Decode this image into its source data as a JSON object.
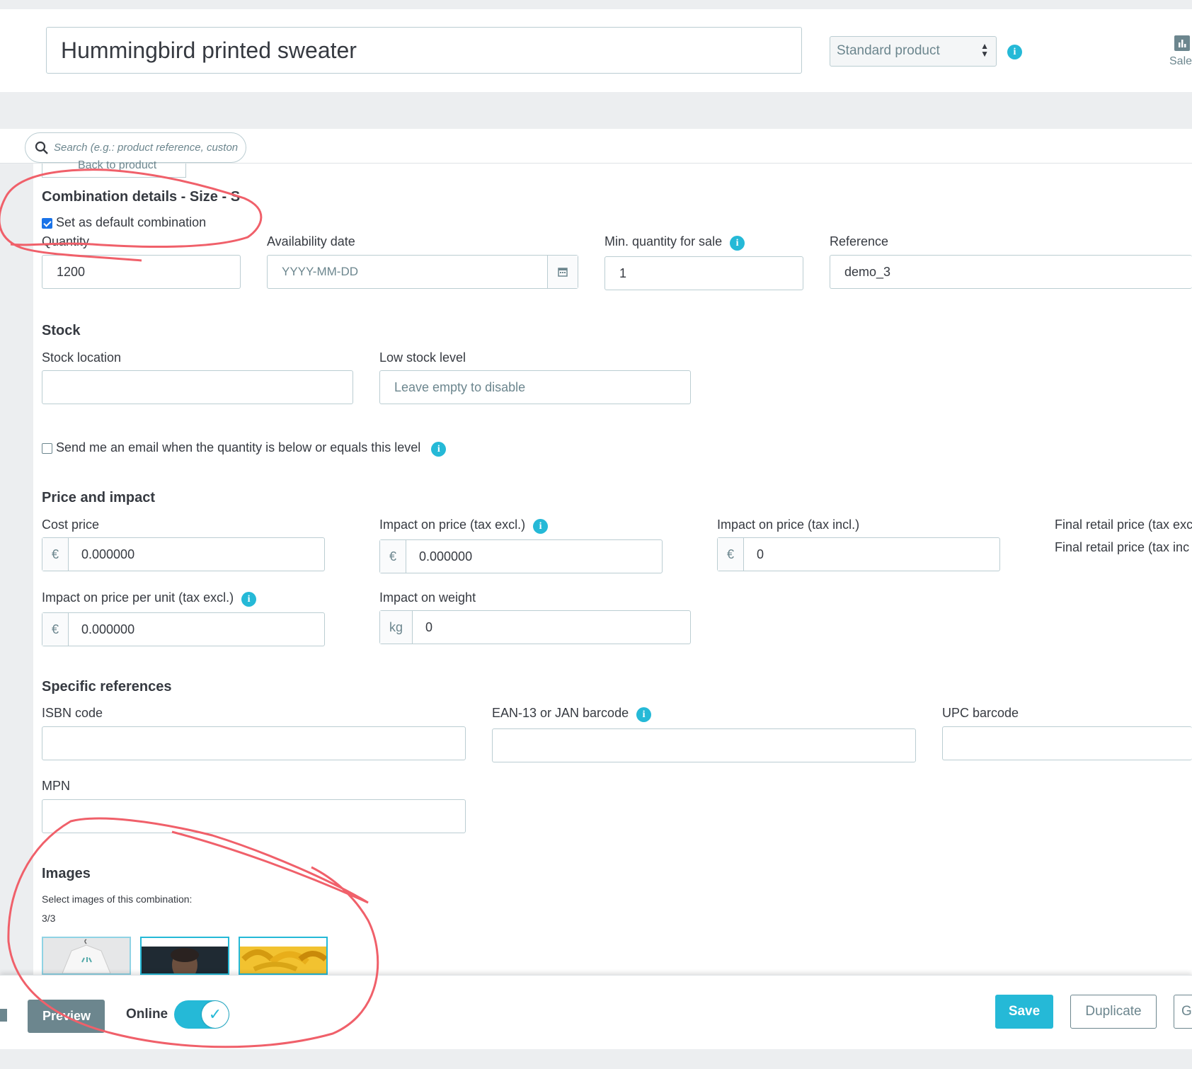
{
  "header": {
    "product_name": "Hummingbird printed sweater",
    "product_type": "Standard product",
    "sales_label": "Sales"
  },
  "search": {
    "placeholder": "Search (e.g.: product reference, custon"
  },
  "back_button": {
    "label": "Back to product"
  },
  "combination": {
    "title": "Combination details - Size - S",
    "default_label": "Set as default combination",
    "default_checked": true,
    "quantity_label": "Quantity",
    "quantity_value": "1200",
    "availability_label": "Availability date",
    "availability_placeholder": "YYYY-MM-DD",
    "min_qty_label": "Min. quantity for sale",
    "min_qty_value": "1",
    "reference_label": "Reference",
    "reference_value": "demo_3"
  },
  "stock": {
    "title": "Stock",
    "location_label": "Stock location",
    "location_value": "",
    "low_label": "Low stock level",
    "low_placeholder": "Leave empty to disable",
    "email_label": "Send me an email when the quantity is below or equals this level",
    "email_checked": false
  },
  "price": {
    "title": "Price and impact",
    "currency": "€",
    "cost_label": "Cost price",
    "cost_value": "0.000000",
    "impact_excl_label": "Impact on price (tax excl.)",
    "impact_excl_value": "0.000000",
    "impact_incl_label": "Impact on price (tax incl.)",
    "impact_incl_value": "0",
    "final_excl_label": "Final retail price (tax exc",
    "final_incl_label": "Final retail price (tax inc",
    "unit_label": "Impact on price per unit (tax excl.)",
    "unit_value": "0.000000",
    "weight_label": "Impact on weight",
    "weight_unit": "kg",
    "weight_value": "0"
  },
  "refs": {
    "title": "Specific references",
    "isbn_label": "ISBN code",
    "ean_label": "EAN-13 or JAN barcode",
    "upc_label": "UPC barcode",
    "mpn_label": "MPN"
  },
  "images": {
    "title": "Images",
    "subtitle": "Select images of this combination:",
    "count": "3/3"
  },
  "footer": {
    "preview_label": "Preview",
    "online_label": "Online",
    "online_on": true,
    "save_label": "Save",
    "duplicate_label": "Duplicate",
    "cut_label": "G"
  },
  "colors": {
    "accent": "#25b9d7",
    "annotation": "#f0606a",
    "secondary": "#6c868e"
  }
}
